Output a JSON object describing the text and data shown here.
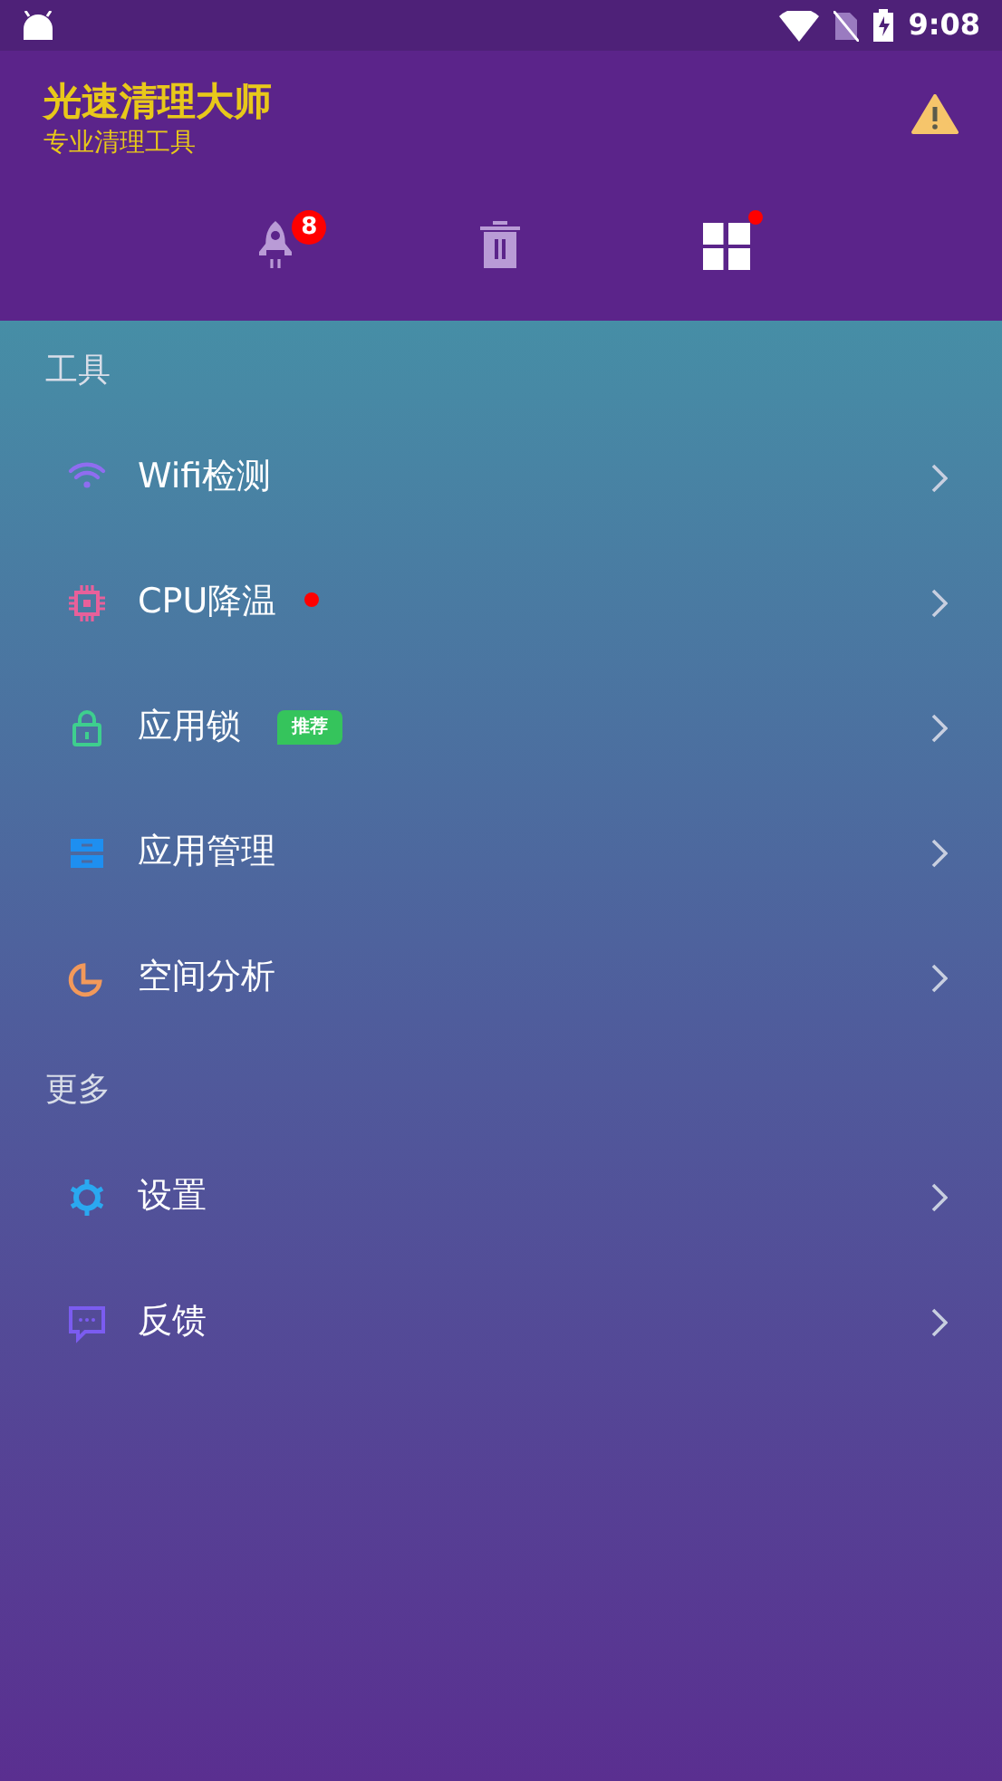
{
  "status_bar": {
    "time": "9:08"
  },
  "header": {
    "title": "光速清理大师",
    "subtitle": "专业清理工具"
  },
  "toolbar": [
    {
      "badge": "8",
      "dot": false
    },
    {
      "dot": false
    },
    {
      "dot": true
    }
  ],
  "sections": [
    {
      "heading": "工具",
      "items": [
        {
          "label": "Wifi检测",
          "color": "#8f6df0",
          "dot": false
        },
        {
          "label": "CPU降温",
          "color": "#e8609a",
          "dot": true
        },
        {
          "label": "应用锁",
          "color": "#3ecf8e",
          "dot": false,
          "tag": "推荐"
        },
        {
          "label": "应用管理",
          "color": "#1e8ff0",
          "dot": false
        },
        {
          "label": "空间分析",
          "color": "#f2995a",
          "dot": false
        }
      ]
    },
    {
      "heading": "更多",
      "items": [
        {
          "label": "设置",
          "color": "#2aa8f0",
          "dot": false
        },
        {
          "label": "反馈",
          "color": "#7b5cf0",
          "dot": false
        }
      ]
    }
  ]
}
